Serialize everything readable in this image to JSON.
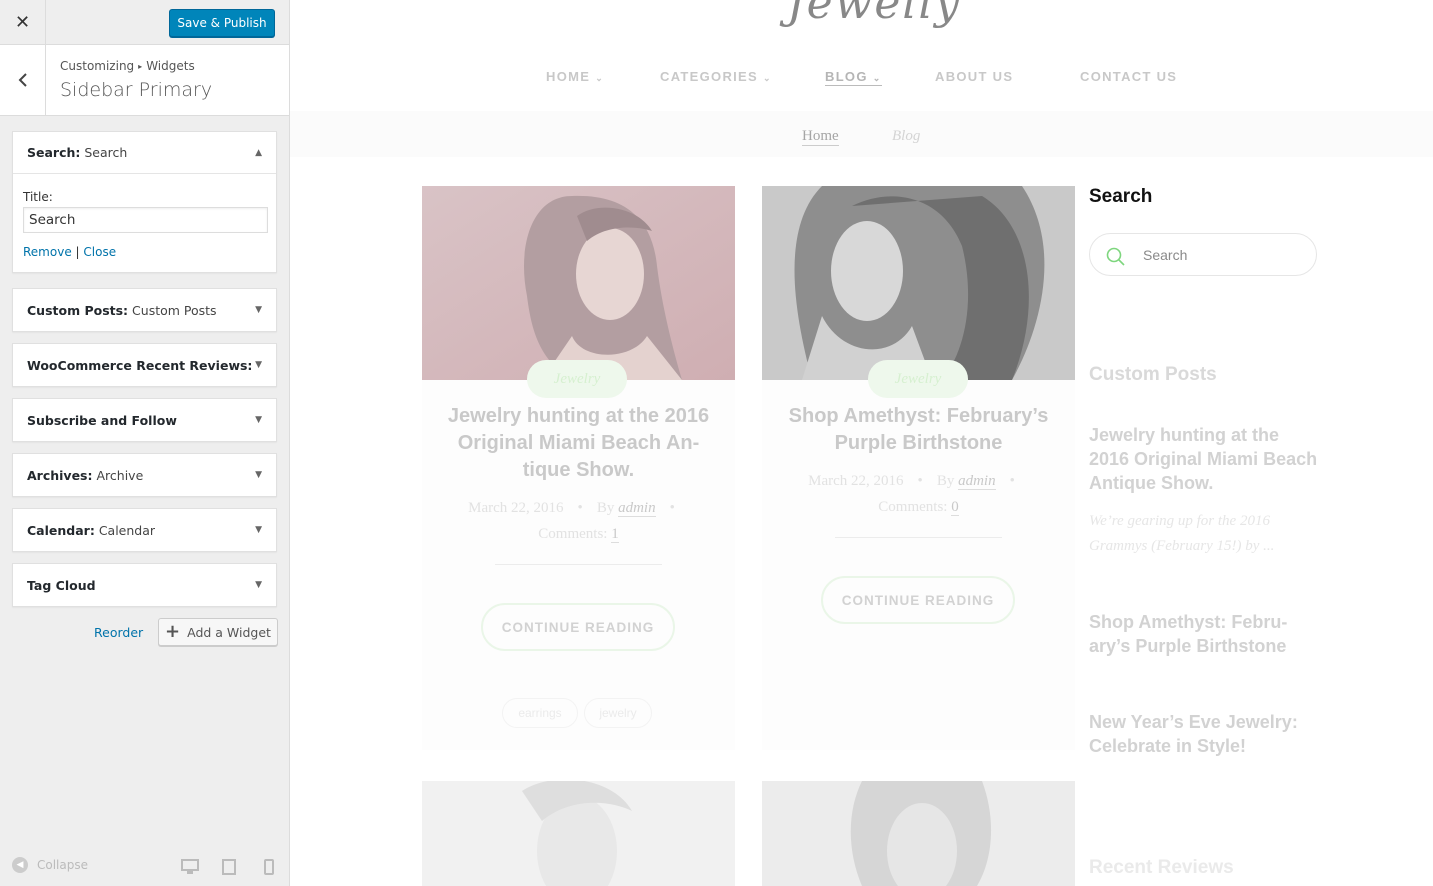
{
  "customizer": {
    "close_label": "✕",
    "publish_label": "Save & Publish",
    "breadcrumb": [
      "Customizing",
      "Widgets"
    ],
    "breadcrumb_sep": "▸",
    "section_title": "Sidebar Primary",
    "widgets": [
      {
        "name": "Search:",
        "sub": "Search",
        "open": true
      },
      {
        "name": "Custom Posts:",
        "sub": "Custom Posts"
      },
      {
        "name": "WooCommerce Recent Reviews: ...",
        "sub": ""
      },
      {
        "name": "Subscribe and Follow",
        "sub": ""
      },
      {
        "name": "Archives:",
        "sub": "Archive"
      },
      {
        "name": "Calendar:",
        "sub": "Calendar"
      },
      {
        "name": "Tag Cloud",
        "sub": ""
      }
    ],
    "search_form": {
      "title_label": "Title:",
      "title_value": "Search",
      "remove_label": "Remove",
      "divider": "|",
      "close_label": "Close"
    },
    "reorder_label": "Reorder",
    "add_widget_label": "Add a Widget",
    "collapse_label": "Collapse"
  },
  "preview": {
    "logo": "Jewelly",
    "nav": [
      {
        "label": "HOME",
        "dropdown": true
      },
      {
        "label": "CATEGORIES",
        "dropdown": true
      },
      {
        "label": "BLOG",
        "dropdown": true,
        "active": true
      },
      {
        "label": "ABOUT US",
        "dropdown": false
      },
      {
        "label": "CONTACT US",
        "dropdown": false
      }
    ],
    "breadcrumb": {
      "home": "Home",
      "current": "Blog"
    },
    "posts": [
      {
        "category": "Jewelry",
        "title": "Jewelry hunting at the 2016 Original Miami Beach An-tique Show.",
        "date": "March 22, 2016",
        "by": "By",
        "author": "admin",
        "comments_label": "Comments:",
        "comments": "1",
        "button": "CONTINUE READING",
        "tags": [
          "earrings",
          "jewelry"
        ]
      },
      {
        "category": "Jewelry",
        "title": "Shop Amethyst: February’s Purple Birthstone",
        "date": "March 22, 2016",
        "by": "By",
        "author": "admin",
        "comments_label": "Comments:",
        "comments": "0",
        "button": "CONTINUE READING",
        "tags": []
      }
    ],
    "sidebar": {
      "search_title": "Search",
      "search_placeholder": "Search",
      "custom_posts_title": "Custom Posts",
      "custom_posts": [
        {
          "title": "Jewelry hunting at the 2016 Original Miami Beach Antique Show.",
          "excerpt": "We’re gearing up for the 2016 Grammys (February 15!) by ..."
        },
        {
          "title": "Shop Amethyst: Febru-ary’s Purple Birthstone",
          "excerpt": ""
        },
        {
          "title": "New Year’s Eve Jewelry: Celebrate in Style!",
          "excerpt": ""
        }
      ],
      "recent_reviews_title": "Recent Reviews"
    },
    "colors": {
      "accent": "#0085ba",
      "link": "#0073aa",
      "search_icon": "#7ed67e"
    }
  }
}
